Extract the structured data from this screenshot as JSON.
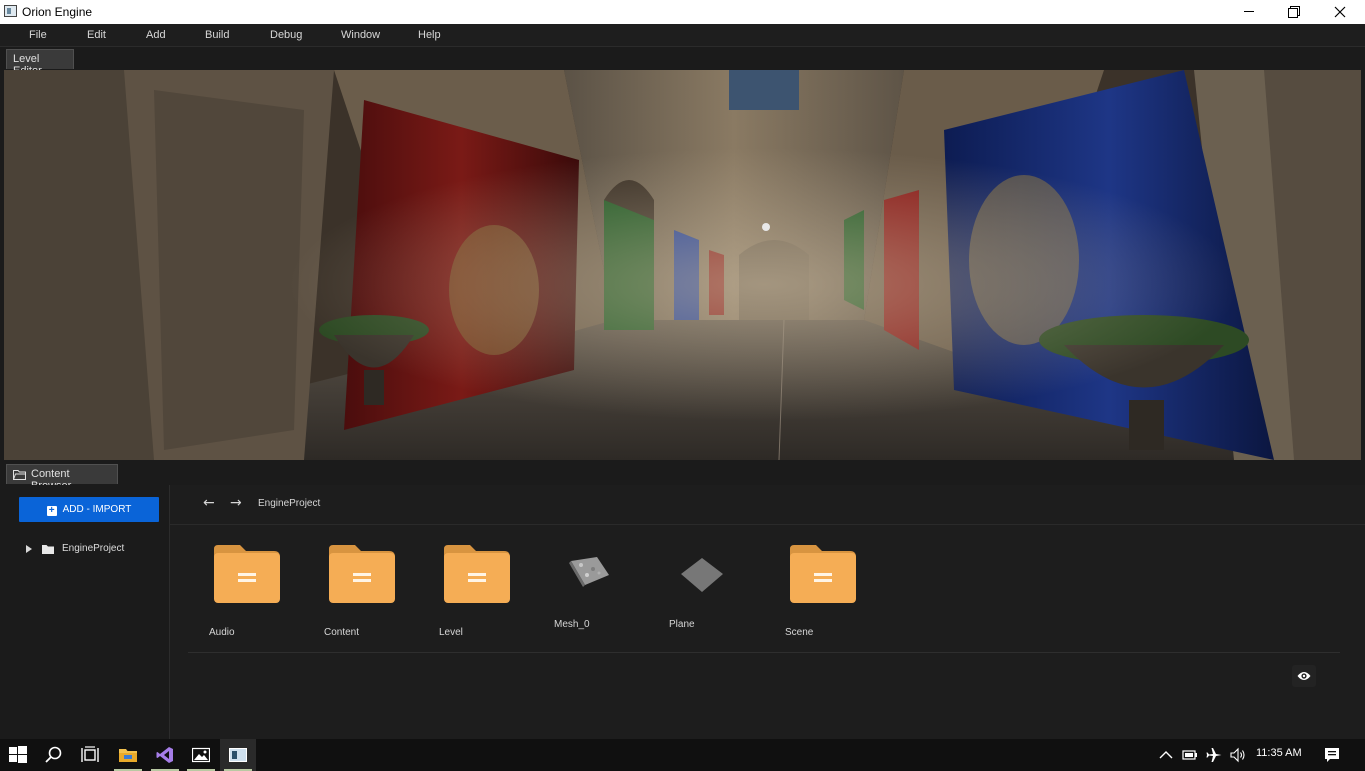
{
  "window": {
    "title": "Orion Engine"
  },
  "menu": [
    "File",
    "Edit",
    "Add",
    "Build",
    "Debug",
    "Window",
    "Help"
  ],
  "tabs": {
    "level_editor": "Level Editor",
    "content_browser": "Content Browser"
  },
  "content_browser": {
    "add_button": "ADD - IMPORT",
    "tree_root": "EngineProject",
    "path": "EngineProject",
    "items": [
      {
        "label": "Audio",
        "kind": "folder"
      },
      {
        "label": "Content",
        "kind": "folder"
      },
      {
        "label": "Level",
        "kind": "folder"
      },
      {
        "label": "Mesh_0",
        "kind": "mesh"
      },
      {
        "label": "Plane",
        "kind": "plane"
      },
      {
        "label": "Scene",
        "kind": "folder"
      }
    ]
  },
  "taskbar": {
    "clock": "11:35 AM",
    "apps": [
      "windows-start-icon",
      "search-icon",
      "task-view-icon",
      "file-explorer-icon",
      "visual-studio-icon",
      "photos-icon",
      "orion-engine-icon"
    ]
  },
  "colors": {
    "accent": "#0a64d8",
    "folder": "#f5ad55",
    "folder_tab": "#d89440"
  }
}
